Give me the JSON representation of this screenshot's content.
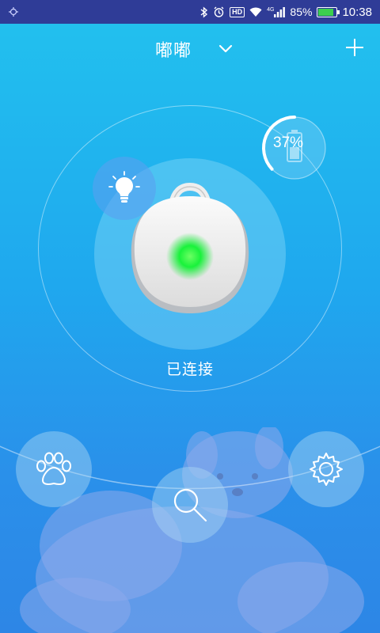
{
  "status_bar": {
    "battery_percent": "85%",
    "time": "10:38",
    "network": "4G",
    "hd_label": "HD",
    "battery_level": 0.85
  },
  "header": {
    "title": "嘟嘟"
  },
  "device": {
    "battery_text": "37%",
    "battery_level": 0.37,
    "connection_status": "已连接",
    "led_color": "#19f23b"
  },
  "icons": [
    "notification-icon",
    "bluetooth-icon",
    "alarm-icon",
    "hd-icon",
    "signal-icon",
    "wifi-icon",
    "battery-icon",
    "chevron-down-icon",
    "plus-icon",
    "light-bulb-icon",
    "battery-gauge-icon",
    "paw-icon",
    "search-icon",
    "gear-icon"
  ]
}
